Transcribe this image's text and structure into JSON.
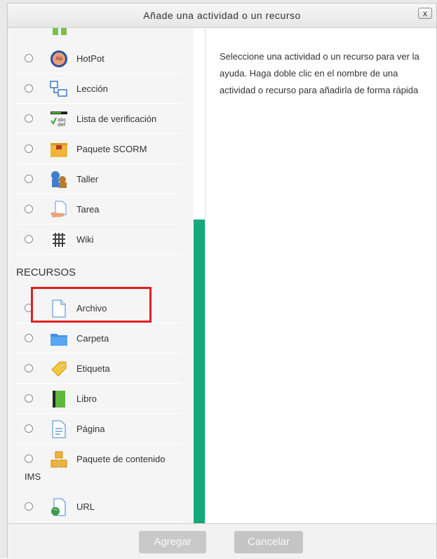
{
  "dialog": {
    "title": "Añade una actividad o un recurso",
    "close": "x"
  },
  "help_text": "Seleccione una actividad o un recurso para ver la ayuda. Haga doble clic en el nombre de una actividad o recurso para añadirla de forma rápida",
  "activities": [
    {
      "label": "HotPot",
      "icon": "hotpot-icon"
    },
    {
      "label": "Lección",
      "icon": "lesson-icon"
    },
    {
      "label": "Lista de verificación",
      "icon": "checklist-icon"
    },
    {
      "label": "Paquete SCORM",
      "icon": "scorm-package-icon"
    },
    {
      "label": "Taller",
      "icon": "workshop-icon"
    },
    {
      "label": "Tarea",
      "icon": "assignment-icon"
    },
    {
      "label": "Wiki",
      "icon": "wiki-icon"
    }
  ],
  "resources_heading": "RECURSOS",
  "resources": [
    {
      "label": "Archivo",
      "icon": "file-icon"
    },
    {
      "label": "Carpeta",
      "icon": "folder-icon"
    },
    {
      "label": "Etiqueta",
      "icon": "label-tag-icon"
    },
    {
      "label": "Libro",
      "icon": "book-icon"
    },
    {
      "label": "Página",
      "icon": "page-icon"
    },
    {
      "label": "Paquete de contenido",
      "icon": "ims-package-icon"
    },
    {
      "label": "URL",
      "icon": "url-icon"
    }
  ],
  "ims_suffix": "IMS",
  "buttons": {
    "add": "Agregar",
    "cancel": "Cancelar"
  },
  "colors": {
    "accent_green": "#16a87a",
    "highlight_red": "#e02020"
  }
}
